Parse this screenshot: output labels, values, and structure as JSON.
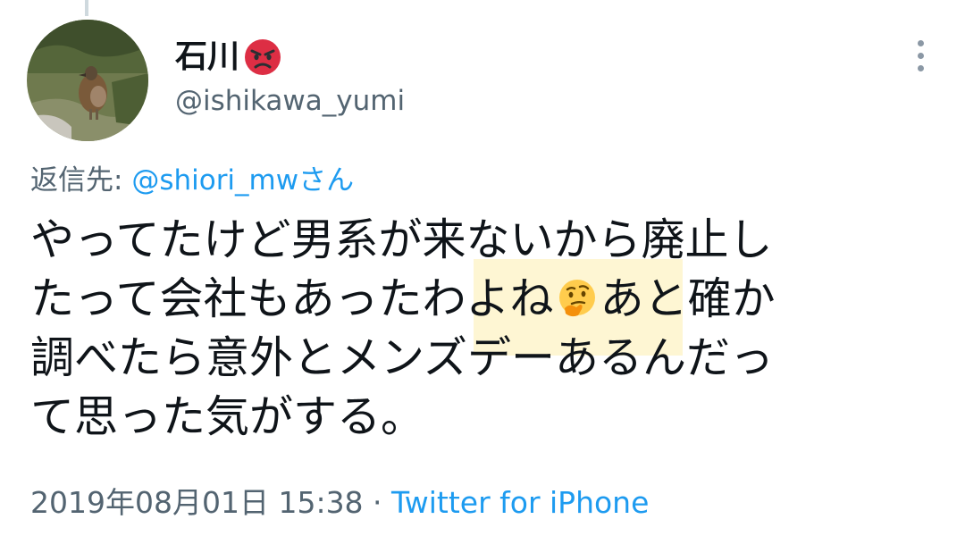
{
  "tweet": {
    "author": {
      "display_name": "石川",
      "name_emoji": "pouting-face-icon",
      "handle": "@ishikawa_yumi"
    },
    "reply_to": {
      "prefix": "返信先: ",
      "mention": "@shiori_mw",
      "suffix": "さん"
    },
    "text_lines": [
      "やってたけど男系が来ないから廃止し",
      "たって会社もあったわよね",
      "あと確か",
      "調べたら意外とメンズデーあるんだっ",
      "て思った気がする。"
    ],
    "inline_emoji": "thinking-face-icon",
    "timestamp": "2019年08月01日 15:38",
    "separator": " · ",
    "source": "Twitter for iPhone"
  },
  "colors": {
    "text": "#0f1419",
    "secondary": "#536471",
    "link": "#1d9bf0",
    "highlight": "#fce88c"
  }
}
